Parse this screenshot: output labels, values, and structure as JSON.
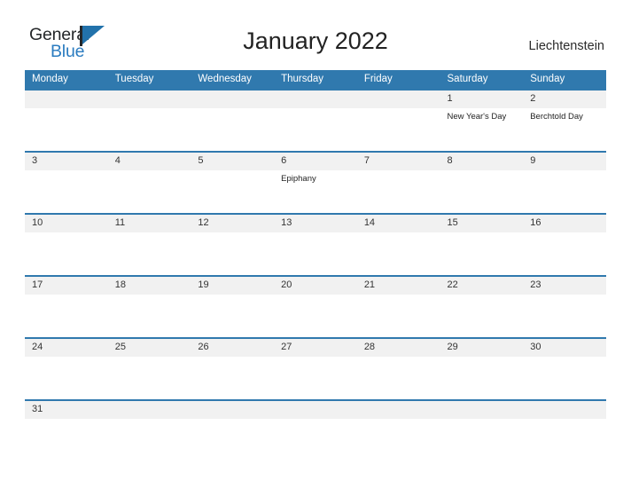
{
  "brand": {
    "name_part1": "General",
    "name_part2": "Blue",
    "flag_icon": "flag-triangle-icon",
    "color_dark": "#25282a",
    "color_blue": "#2b7cc0"
  },
  "header": {
    "title": "January 2022",
    "country": "Liechtenstein"
  },
  "theme": {
    "header_blue": "#3079ae",
    "row_gray": "#f1f1f1",
    "rule_blue": "#3079ae"
  },
  "calendar": {
    "weekday_headers": [
      "Monday",
      "Tuesday",
      "Wednesday",
      "Thursday",
      "Friday",
      "Saturday",
      "Sunday"
    ],
    "weeks": [
      {
        "days": [
          {
            "num": "",
            "event": ""
          },
          {
            "num": "",
            "event": ""
          },
          {
            "num": "",
            "event": ""
          },
          {
            "num": "",
            "event": ""
          },
          {
            "num": "",
            "event": ""
          },
          {
            "num": "1",
            "event": "New Year's Day"
          },
          {
            "num": "2",
            "event": "Berchtold Day"
          }
        ]
      },
      {
        "days": [
          {
            "num": "3",
            "event": ""
          },
          {
            "num": "4",
            "event": ""
          },
          {
            "num": "5",
            "event": ""
          },
          {
            "num": "6",
            "event": "Epiphany"
          },
          {
            "num": "7",
            "event": ""
          },
          {
            "num": "8",
            "event": ""
          },
          {
            "num": "9",
            "event": ""
          }
        ]
      },
      {
        "days": [
          {
            "num": "10",
            "event": ""
          },
          {
            "num": "11",
            "event": ""
          },
          {
            "num": "12",
            "event": ""
          },
          {
            "num": "13",
            "event": ""
          },
          {
            "num": "14",
            "event": ""
          },
          {
            "num": "15",
            "event": ""
          },
          {
            "num": "16",
            "event": ""
          }
        ]
      },
      {
        "days": [
          {
            "num": "17",
            "event": ""
          },
          {
            "num": "18",
            "event": ""
          },
          {
            "num": "19",
            "event": ""
          },
          {
            "num": "20",
            "event": ""
          },
          {
            "num": "21",
            "event": ""
          },
          {
            "num": "22",
            "event": ""
          },
          {
            "num": "23",
            "event": ""
          }
        ]
      },
      {
        "days": [
          {
            "num": "24",
            "event": ""
          },
          {
            "num": "25",
            "event": ""
          },
          {
            "num": "26",
            "event": ""
          },
          {
            "num": "27",
            "event": ""
          },
          {
            "num": "28",
            "event": ""
          },
          {
            "num": "29",
            "event": ""
          },
          {
            "num": "30",
            "event": ""
          }
        ]
      },
      {
        "days": [
          {
            "num": "31",
            "event": ""
          },
          {
            "num": "",
            "event": ""
          },
          {
            "num": "",
            "event": ""
          },
          {
            "num": "",
            "event": ""
          },
          {
            "num": "",
            "event": ""
          },
          {
            "num": "",
            "event": ""
          },
          {
            "num": "",
            "event": ""
          }
        ]
      }
    ]
  }
}
